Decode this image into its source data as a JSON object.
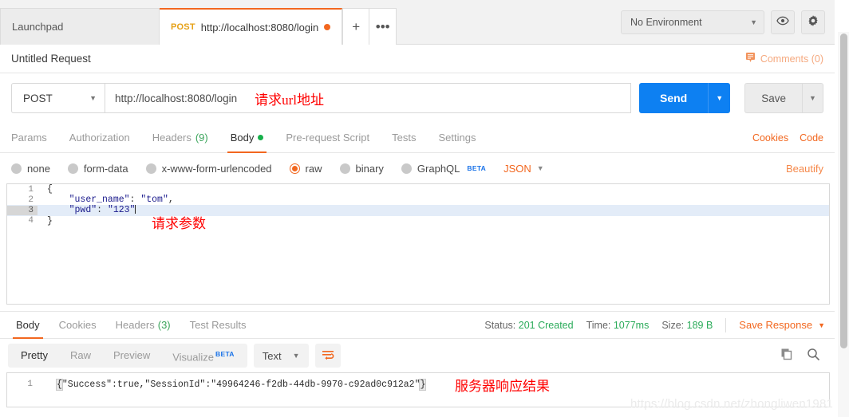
{
  "tabbar": {
    "tabs": [
      {
        "label": "Launchpad",
        "method": "",
        "active": false
      },
      {
        "label": "http://localhost:8080/login",
        "method": "POST",
        "active": true
      }
    ],
    "new_tab_label": "+",
    "more_label": "•••",
    "environment": "No Environment",
    "eye_icon": "eye-icon",
    "gear_icon": "gear-icon"
  },
  "request_header": {
    "title": "Untitled Request",
    "comments_label": "Comments (0)",
    "comment_icon": "comment-icon"
  },
  "url_row": {
    "method": "POST",
    "url": "http://localhost:8080/login",
    "annotation": "请求url地址",
    "send_label": "Send",
    "save_label": "Save"
  },
  "request_tabs": {
    "items": [
      {
        "label": "Params",
        "active": false,
        "count": "",
        "dot": false
      },
      {
        "label": "Authorization",
        "active": false,
        "count": "",
        "dot": false
      },
      {
        "label": "Headers",
        "active": false,
        "count": "(9)",
        "dot": false
      },
      {
        "label": "Body",
        "active": true,
        "count": "",
        "dot": true
      },
      {
        "label": "Pre-request Script",
        "active": false,
        "count": "",
        "dot": false
      },
      {
        "label": "Tests",
        "active": false,
        "count": "",
        "dot": false
      },
      {
        "label": "Settings",
        "active": false,
        "count": "",
        "dot": false
      }
    ],
    "cookies_label": "Cookies",
    "code_label": "Code"
  },
  "body_type": {
    "options": [
      {
        "label": "none",
        "selected": false,
        "beta": false
      },
      {
        "label": "form-data",
        "selected": false,
        "beta": false
      },
      {
        "label": "x-www-form-urlencoded",
        "selected": false,
        "beta": false
      },
      {
        "label": "raw",
        "selected": true,
        "beta": false
      },
      {
        "label": "binary",
        "selected": false,
        "beta": false
      },
      {
        "label": "GraphQL",
        "selected": false,
        "beta": true
      }
    ],
    "beta_badge": "BETA",
    "format": "JSON",
    "beautify_label": "Beautify"
  },
  "editor": {
    "lines": [
      {
        "n": "1",
        "fold": true,
        "text": "{",
        "highlight": false
      },
      {
        "n": "2",
        "key": "\"user_name\"",
        "sep": ": ",
        "value": "\"tom\"",
        "tail": ",",
        "highlight": false
      },
      {
        "n": "3",
        "key": "\"pwd\"",
        "sep": ": ",
        "value": "\"123\"",
        "tail": "",
        "highlight": true
      },
      {
        "n": "4",
        "text": "}",
        "highlight": false
      }
    ],
    "annotation": "请求参数"
  },
  "response": {
    "tabs": [
      {
        "label": "Body",
        "active": true,
        "count": ""
      },
      {
        "label": "Cookies",
        "active": false,
        "count": ""
      },
      {
        "label": "Headers",
        "active": false,
        "count": "(3)"
      },
      {
        "label": "Test Results",
        "active": false,
        "count": ""
      }
    ],
    "status_label": "Status:",
    "status_value": "201 Created",
    "time_label": "Time:",
    "time_value": "1077ms",
    "size_label": "Size:",
    "size_value": "189 B",
    "save_response_label": "Save Response",
    "view_modes": [
      {
        "label": "Pretty",
        "active": true,
        "beta": false
      },
      {
        "label": "Raw",
        "active": false,
        "beta": false
      },
      {
        "label": "Preview",
        "active": false,
        "beta": false
      },
      {
        "label": "Visualize",
        "active": false,
        "beta": true
      }
    ],
    "beta_badge": "BETA",
    "format": "Text",
    "wrap_icon": "wrap-lines-icon",
    "copy_icon": "copy-icon",
    "search_icon": "search-icon",
    "body_line_number": "1",
    "body_open_brace": "{",
    "body_text": "\"Success\":true,\"SessionId\":\"49964246-f2db-44db-9970-c92ad0c912a2\"",
    "body_close_brace": "}",
    "annotation": "服务器响应结果"
  },
  "watermark": "https://blog.csdn.net/zhongliwen1981",
  "colors": {
    "accent_orange": "#f2671f",
    "send_blue": "#0d80f2",
    "status_green": "#2bab5a",
    "annotation_red": "#ff0000",
    "method_amber": "#e6a117"
  }
}
